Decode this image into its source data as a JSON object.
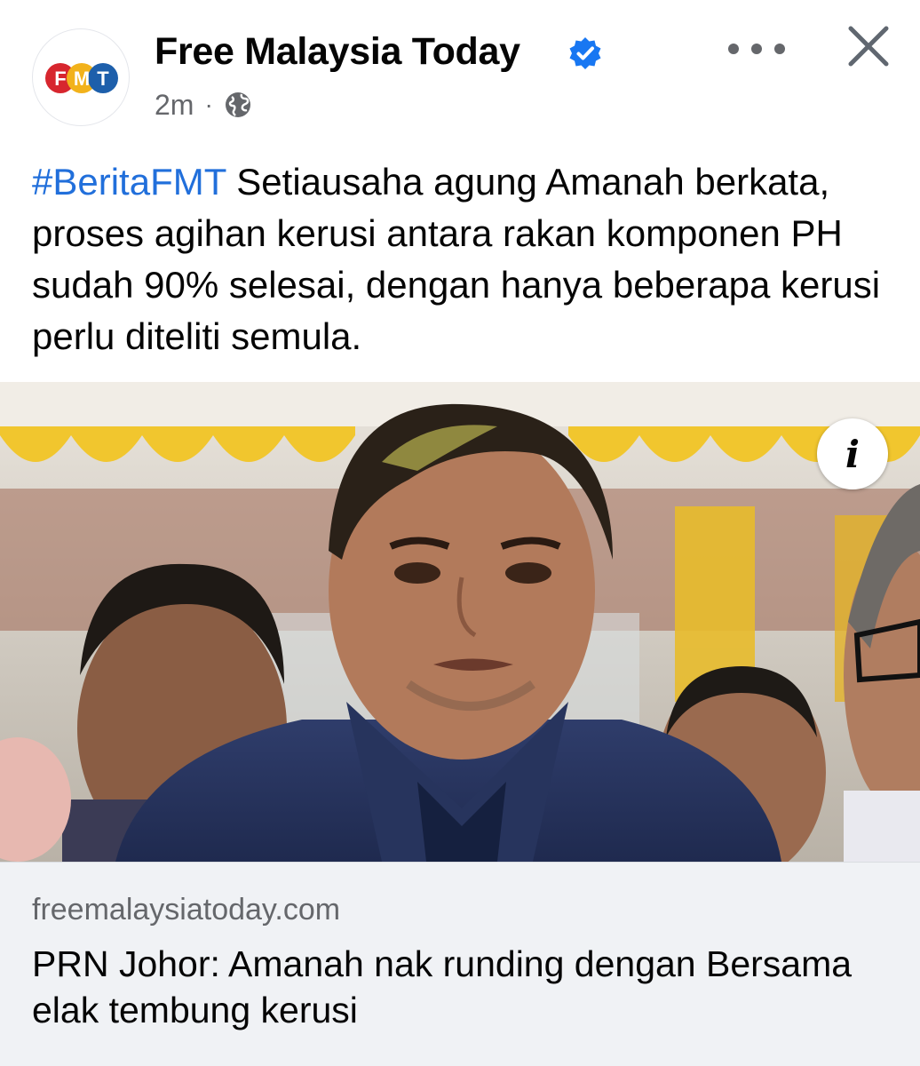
{
  "post": {
    "page_name": "Free Malaysia Today",
    "avatar_logo_letters": [
      "F",
      "M",
      "T"
    ],
    "time": "2m",
    "separator": "·",
    "audience_icon": "globe-icon",
    "verified_icon": "verified-badge-icon",
    "more_icon": "more-options-icon",
    "close_icon": "close-icon",
    "hashtag": "#BeritaFMT",
    "body": " Setiausaha agung Amanah berkata, proses agihan kerusi antara rakan komponen PH sudah 90% selesai, dengan hanya beberapa kerusi perlu diteliti semula."
  },
  "media": {
    "info_button": "i",
    "info_icon": "info-icon"
  },
  "link": {
    "domain": "freemalaysiatoday.com",
    "title": "PRN Johor: Amanah nak runding dengan Bersama elak tembung kerusi"
  },
  "colors": {
    "hashtag": "#216fdb",
    "verified": "#1877f2",
    "secondary_text": "#65676b",
    "link_card_bg": "#f0f2f5",
    "logo_red": "#d7262e",
    "logo_yellow": "#f2b21b",
    "logo_blue": "#1d5fab"
  }
}
